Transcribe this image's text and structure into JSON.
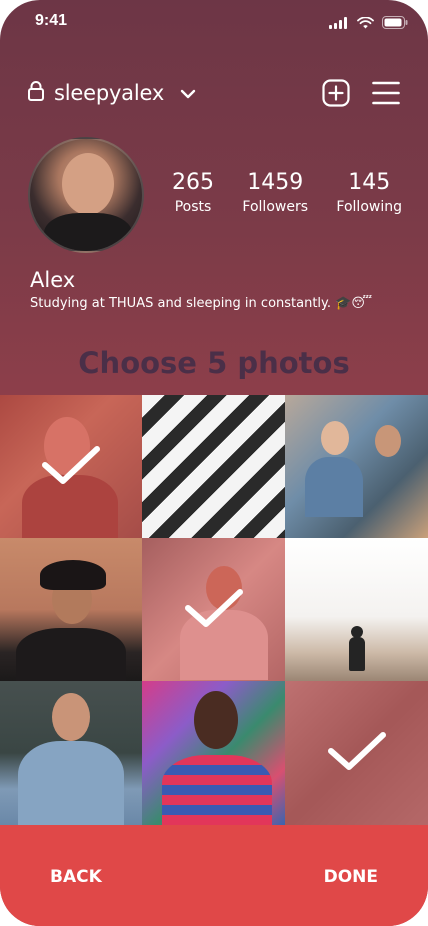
{
  "status_bar": {
    "time": "9:41",
    "icons": [
      "signal-icon",
      "wifi-icon",
      "battery-icon"
    ]
  },
  "header": {
    "username": "sleepyalex",
    "icons": [
      "lock-icon",
      "chevron-down-icon",
      "add-post-icon",
      "menu-icon"
    ]
  },
  "profile": {
    "stats": [
      {
        "value": "265",
        "label": "Posts"
      },
      {
        "value": "1459",
        "label": "Followers"
      },
      {
        "value": "145",
        "label": "Following"
      }
    ],
    "name": "Alex",
    "bio": "Studying at THUAS and sleeping in constantly. 🎓😴"
  },
  "picker": {
    "title": "Choose 5 photos",
    "photos": [
      {
        "selected": true
      },
      {
        "selected": false
      },
      {
        "selected": false
      },
      {
        "selected": false
      },
      {
        "selected": true
      },
      {
        "selected": false
      },
      {
        "selected": false
      },
      {
        "selected": false
      },
      {
        "selected": true
      }
    ]
  },
  "footer": {
    "back_label": "BACK",
    "done_label": "DONE"
  },
  "colors": {
    "accent": "#e04848",
    "title": "#4a2f48",
    "overlay": "#d64949"
  }
}
